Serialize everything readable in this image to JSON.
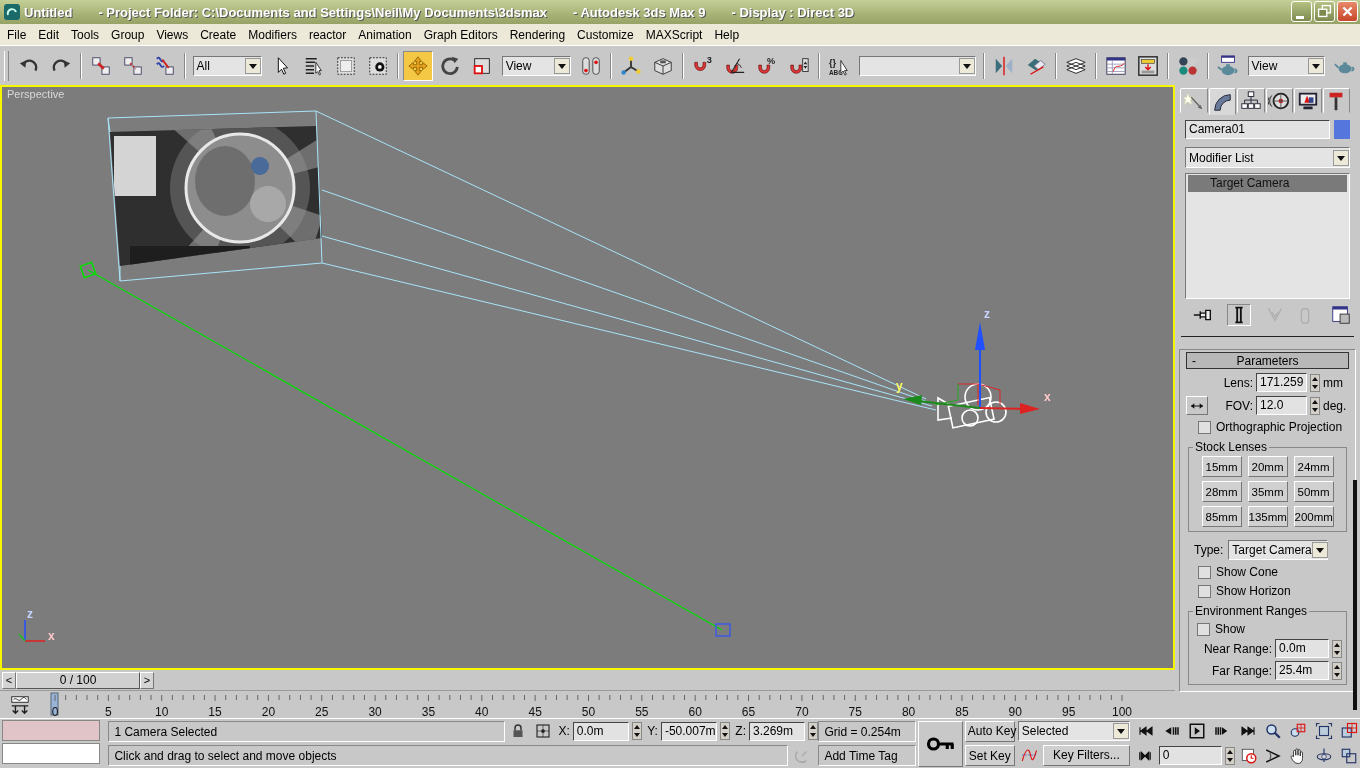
{
  "window": {
    "title_parts": [
      "Untitled",
      "- Project Folder: C:\\Documents and Settings\\Neil\\My Documents\\3dsmax",
      "- Autodesk 3ds Max 9",
      "- Display : Direct 3D"
    ]
  },
  "menu": [
    "File",
    "Edit",
    "Tools",
    "Group",
    "Views",
    "Create",
    "Modifiers",
    "reactor",
    "Animation",
    "Graph Editors",
    "Rendering",
    "Customize",
    "MAXScript",
    "Help"
  ],
  "toolbar": {
    "selection_filter": "All",
    "reference_coordinate_system": "View",
    "render_type": "View",
    "snap_mark": "3",
    "percent_mark": "%",
    "named_selection_marks": [
      "{}",
      "ABC"
    ],
    "buttons": [
      {
        "selected": false
      },
      {
        "selected": false
      },
      {
        "selected": false
      },
      {
        "selected": false
      },
      {
        "selected": false
      },
      {
        "selected": false
      },
      {
        "selected": false
      },
      {
        "selected": false
      },
      {
        "selected": false
      },
      {
        "selected": true
      },
      {
        "selected": false
      },
      {
        "selected": false
      },
      {
        "selected": false
      },
      {
        "selected": false
      },
      {
        "selected": false
      },
      {
        "selected": false
      },
      {
        "selected": false
      },
      {
        "selected": false
      },
      {
        "selected": false
      },
      {
        "selected": false
      },
      {
        "selected": false
      },
      {
        "selected": false
      },
      {
        "selected": false
      },
      {
        "selected": false
      },
      {
        "selected": false
      },
      {
        "selected": false
      },
      {
        "selected": false
      },
      {
        "selected": false
      }
    ]
  },
  "viewport": {
    "label": "Perspective",
    "gizmo_labels": [
      "z",
      "y",
      "x"
    ],
    "corner_axis_labels": [
      "z",
      "x"
    ]
  },
  "command_panel": {
    "tabs": [
      {
        "selected": false
      },
      {
        "selected": true
      },
      {
        "selected": false
      },
      {
        "selected": false
      },
      {
        "selected": false
      },
      {
        "selected": false
      }
    ],
    "object_name": "Camera01",
    "modifier_list": "Modifier List",
    "stack": [
      {
        "label": "Target Camera",
        "selected": true
      }
    ],
    "stack_buttons": [
      {
        "selected": false,
        "disabled": false
      },
      {
        "selected": true,
        "disabled": false
      },
      {
        "selected": false,
        "disabled": true
      },
      {
        "selected": false,
        "disabled": true
      },
      {
        "selected": false,
        "disabled": false
      }
    ],
    "rollout": {
      "collapse": "-",
      "title": "Parameters",
      "lens_label": "Lens:",
      "lens": "171.259",
      "lens_unit": "mm",
      "fov_label": "FOV:",
      "fov": "12.0",
      "fov_unit": "deg.",
      "ortho": {
        "label": "Orthographic Projection",
        "checked": false
      },
      "stock_lenses": {
        "title": "Stock Lenses",
        "buttons": [
          "15mm",
          "20mm",
          "24mm",
          "28mm",
          "35mm",
          "50mm",
          "85mm",
          "135mm",
          "200mm"
        ]
      },
      "type_label": "Type:",
      "type": "Target Camera",
      "options": [
        {
          "label": "Show Cone",
          "checked": false
        },
        {
          "label": "Show Horizon",
          "checked": false
        }
      ],
      "environment": {
        "title": "Environment Ranges",
        "show": {
          "label": "Show",
          "checked": false
        },
        "near_label": "Near Range:",
        "near": "0.0m",
        "far_label": "Far Range:",
        "far": "25.4m"
      }
    }
  },
  "time_slider": {
    "prev": "<",
    "position": "0 / 100",
    "next": ">",
    "level": 0,
    "ticks": [
      "0",
      "5",
      "10",
      "15",
      "20",
      "25",
      "30",
      "35",
      "40",
      "45",
      "50",
      "55",
      "60",
      "65",
      "70",
      "75",
      "80",
      "85",
      "90",
      "95",
      "100"
    ]
  },
  "status": {
    "selection": "1 Camera Selected",
    "prompt": "Click and drag to select and move objects",
    "x_label": "X:",
    "x": "0.0m",
    "y_label": "Y:",
    "y": "-50.007m",
    "z_label": "Z:",
    "z": "3.269m",
    "grid": "Grid = 0.254m",
    "time_tag": "Add Time Tag"
  },
  "animation": {
    "auto_key": "Auto Key",
    "set_key": "Set Key",
    "key_mode": "Selected",
    "key_filters": "Key Filters...",
    "frame": "0"
  }
}
